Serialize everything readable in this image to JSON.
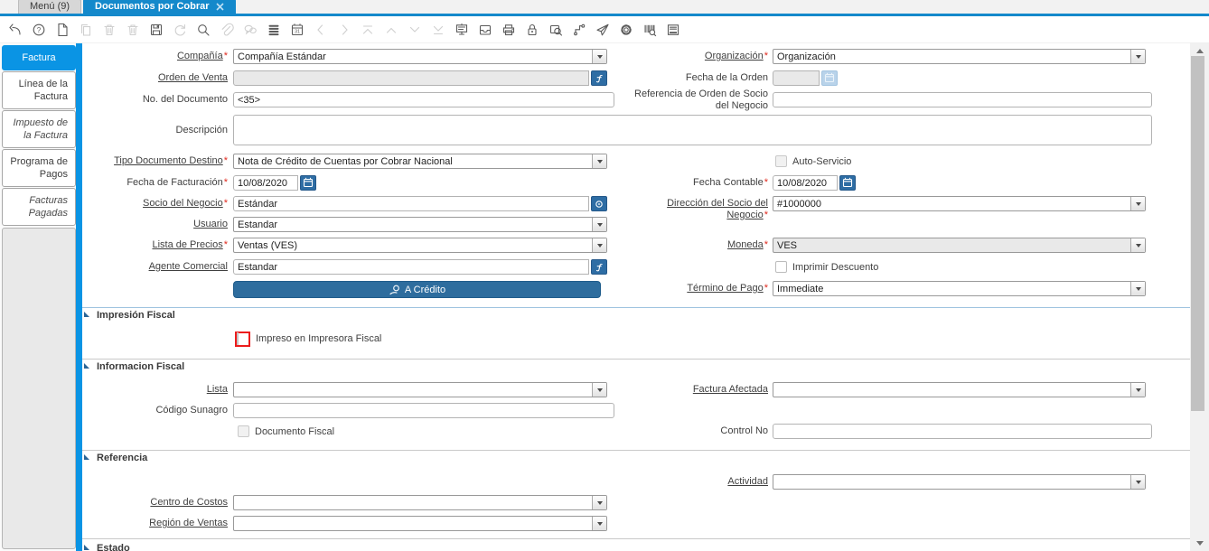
{
  "title_tabs": {
    "menu_label": "Menú (9)",
    "active_label": "Documentos por Cobrar"
  },
  "toolbar": {
    "calendar_day": "31",
    "help_glyph": "?",
    "icons": [
      "undo-icon",
      "help-icon",
      "new-record-icon",
      "copy-record-icon",
      "delete-record-icon",
      "delete-selection-icon",
      "save-icon",
      "refresh-icon",
      "find-icon",
      "attachment-icon",
      "chat-icon",
      "grid-toggle-icon",
      "calendar-requests-icon",
      "previous-record-icon",
      "next-record-icon",
      "parent-record-icon",
      "up-record-icon",
      "down-record-icon",
      "detail-record-icon",
      "report-icon",
      "archive-icon",
      "print-icon",
      "lock-icon",
      "zoom-across-icon",
      "workflow-icon",
      "send-mail-icon",
      "preferences-icon",
      "product-info-icon",
      "print-preview-icon"
    ]
  },
  "sidebar": {
    "tabs": [
      {
        "label": "Factura"
      },
      {
        "label": "Línea de la Factura"
      },
      {
        "label": "Impuesto de la Factura"
      },
      {
        "label": "Programa de Pagos"
      },
      {
        "label": "Facturas Pagadas"
      }
    ]
  },
  "form": {
    "compania": {
      "label": "Compañía",
      "value": "Compañía Estándar"
    },
    "organizacion": {
      "label": "Organización",
      "value": "Organización"
    },
    "orden_venta": {
      "label": "Orden de Venta",
      "value": ""
    },
    "fecha_orden": {
      "label": "Fecha de la Orden",
      "value": ""
    },
    "no_documento": {
      "label": "No. del Documento",
      "value": "<35>"
    },
    "referencia_orden": {
      "label": "Referencia de Orden de Socio del Negocio",
      "value": ""
    },
    "descripcion": {
      "label": "Descripción",
      "value": ""
    },
    "tipo_documento": {
      "label": "Tipo Documento Destino",
      "value": "Nota de Crédito de Cuentas por Cobrar Nacional"
    },
    "auto_servicio": {
      "label": "Auto-Servicio"
    },
    "fecha_facturacion": {
      "label": "Fecha de Facturación",
      "value": "10/08/2020"
    },
    "fecha_contable": {
      "label": "Fecha Contable",
      "value": "10/08/2020"
    },
    "socio_negocio": {
      "label": "Socio del Negocio",
      "value": "Estándar"
    },
    "direccion_socio": {
      "label": "Dirección del Socio del Negocio",
      "value": "#1000000"
    },
    "usuario": {
      "label": "Usuario",
      "value": "Estandar"
    },
    "lista_precios": {
      "label": "Lista de Precios",
      "value": "Ventas (VES)"
    },
    "moneda": {
      "label": "Moneda",
      "value": "VES"
    },
    "agente_comercial": {
      "label": "Agente Comercial",
      "value": "Estandar"
    },
    "imprimir_descuento": {
      "label": "Imprimir Descuento"
    },
    "a_credito": {
      "label": "A Crédito"
    },
    "termino_pago": {
      "label": "Término de Pago",
      "value": "Immediate"
    }
  },
  "sections": {
    "impresion_fiscal": {
      "title": "Impresión Fiscal",
      "impreso_label": "Impreso en Impresora Fiscal"
    },
    "informacion_fiscal": {
      "title": "Informacion Fiscal",
      "lista": {
        "label": "Lista",
        "value": ""
      },
      "factura_afectada": {
        "label": "Factura Afectada",
        "value": ""
      },
      "codigo_sunagro": {
        "label": "Código Sunagro",
        "value": ""
      },
      "documento_fiscal_label": "Documento Fiscal",
      "control_no": {
        "label": "Control No",
        "value": ""
      }
    },
    "referencia": {
      "title": "Referencia",
      "actividad": {
        "label": "Actividad",
        "value": ""
      },
      "centro_costos": {
        "label": "Centro de Costos",
        "value": ""
      },
      "region_ventas": {
        "label": "Región de Ventas",
        "value": ""
      }
    },
    "estado": {
      "title": "Estado"
    }
  },
  "misc": {
    "required": "*"
  },
  "colors": {
    "accent_blue": "#0a94e4",
    "tab_blue": "#1489cb",
    "button_blue": "#2e6da4",
    "required_red": "#e02b20",
    "highlight_red": "#ec1c1c"
  }
}
